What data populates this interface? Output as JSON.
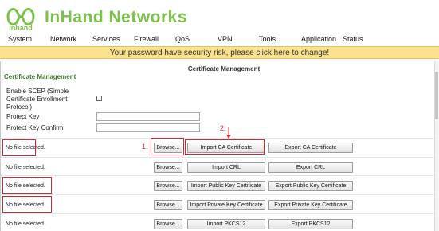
{
  "brand": {
    "name": "InHand Networks",
    "logo_text": "inhand"
  },
  "nav": {
    "items": [
      "System",
      "Network",
      "Services",
      "Firewall",
      "QoS",
      "VPN",
      "Tools",
      "Application",
      "Status"
    ]
  },
  "banner": {
    "text": "Your password have security risk, please click here to change!"
  },
  "panel": {
    "title": "Certificate Management",
    "section_title": "Certificate Management"
  },
  "form": {
    "scep_label": "Enable SCEP (Simple Certificate Enrollment Protocol)",
    "scep_checked": false,
    "protect_key_label": "Protect Key",
    "protect_key_value": "",
    "protect_key_confirm_label": "Protect Key Confirm",
    "protect_key_confirm_value": ""
  },
  "file_rows": [
    {
      "file_text": "No file selected.",
      "browse": "Browse...",
      "import": "Import CA Certificate",
      "export": "Export CA Certificate"
    },
    {
      "file_text": "No file selected.",
      "browse": "Browse...",
      "import": "Import CRL",
      "export": "Export CRL"
    },
    {
      "file_text": "No file selected.",
      "browse": "Browse...",
      "import": "Import Public Key Certificate",
      "export": "Export Public Key Certificate"
    },
    {
      "file_text": "No file selected.",
      "browse": "Browse...",
      "import": "Import Private Key Certificate",
      "export": "Export Private Key Certificate"
    },
    {
      "file_text": "No file selected.",
      "browse": "Browse...",
      "import": "Import PKCS12",
      "export": "Export PKCS12"
    }
  ],
  "annotations": {
    "step1": "1.",
    "step2": "2.",
    "color": "#d8262f"
  },
  "colors": {
    "brand": "#7cc24a",
    "banner": "#fce28f",
    "section_title": "#3d7a2a"
  }
}
